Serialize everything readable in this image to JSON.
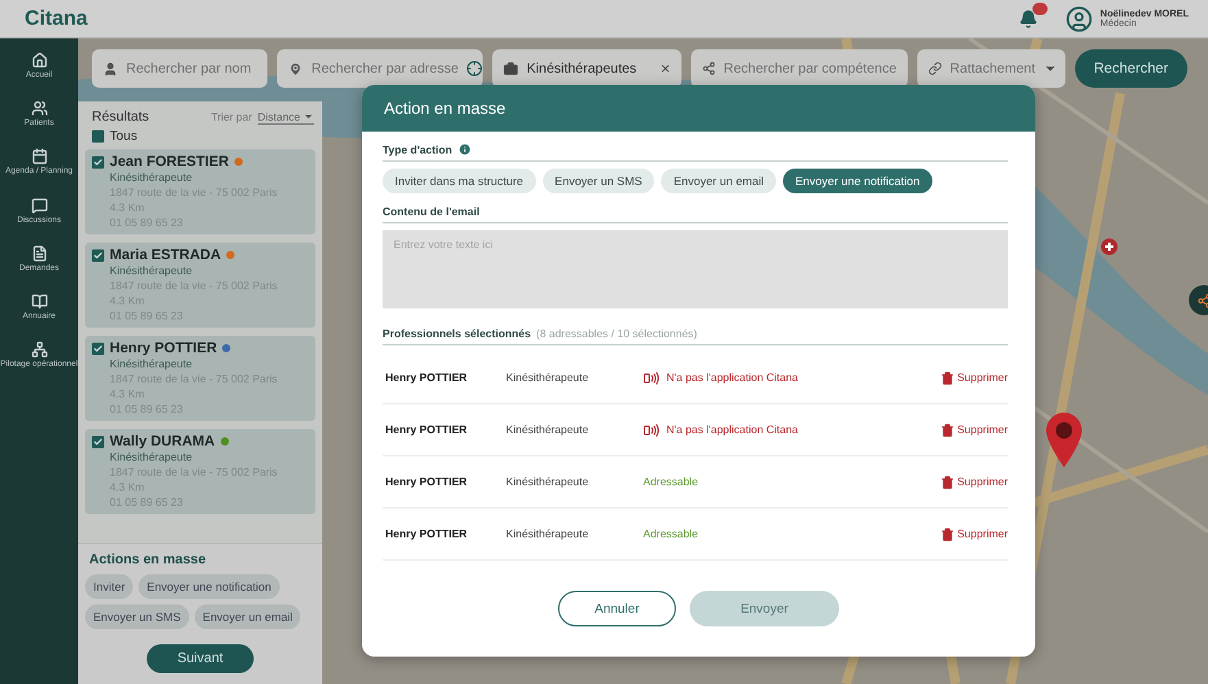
{
  "header": {
    "logo": "Citana",
    "notifications": true,
    "user": {
      "name": "Noëlinedev MOREL",
      "role": "Médecin"
    }
  },
  "sidebar": {
    "items": [
      {
        "kind": "home",
        "label": "Accueil"
      },
      {
        "kind": "patients",
        "label": "Patients"
      },
      {
        "kind": "agenda",
        "label": "Agenda / Planning"
      },
      {
        "kind": "chat",
        "label": "Discussions"
      },
      {
        "kind": "doc",
        "label": "Demandes"
      },
      {
        "kind": "directory",
        "label": "Annuaire"
      },
      {
        "kind": "network",
        "label": "Pilotage opérationnel"
      }
    ]
  },
  "search": {
    "name": {
      "placeholder": "Rechercher par nom"
    },
    "address": {
      "placeholder": "Rechercher par adresse"
    },
    "profession": {
      "value": "Kinésithérapeutes",
      "clear": "×"
    },
    "competence": {
      "placeholder": "Rechercher par compétence"
    },
    "attachment": {
      "placeholder": "Rattachement"
    },
    "submit": "Rechercher"
  },
  "results": {
    "title": "Résultats",
    "sort_label": "Trier par",
    "sort_value": "Distance",
    "all": {
      "label": "Tous",
      "checked": true
    },
    "items": [
      {
        "name": "Jean FORESTIER",
        "color": "#d2691e",
        "checked": true,
        "profession": "Kinésithérapeute",
        "address": "1847 route de la vie - 75 002 Paris",
        "distance": "4.3 Km",
        "phone": "01 05 89 65 23"
      },
      {
        "name": "Maria ESTRADA",
        "color": "#d2691e",
        "checked": true,
        "profession": "Kinésithérapeute",
        "address": "1847 route de la vie - 75 002 Paris",
        "distance": "4.3 Km",
        "phone": "01 05 89 65 23"
      },
      {
        "name": "Henry POTTIER",
        "color": "#3f6aa8",
        "checked": true,
        "profession": "Kinésithérapeute",
        "address": "1847 route de la vie - 75 002 Paris",
        "distance": "4.3 Km",
        "phone": "01 05 89 65 23"
      },
      {
        "name": "Wally DURAMA",
        "color": "#4e8f1f",
        "checked": true,
        "profession": "Kinésithérapeute",
        "address": "1847 route de la vie - 75 002 Paris",
        "distance": "4.3 Km",
        "phone": "01 05 89 65 23"
      }
    ]
  },
  "mass_actions": {
    "title": "Actions en masse",
    "actions": [
      "Inviter",
      "Envoyer une notification",
      "Envoyer un SMS",
      "Envoyer un email"
    ],
    "next": "Suivant"
  },
  "modal": {
    "title": "Action en masse",
    "action_type": {
      "label": "Type d'action",
      "options": [
        {
          "label": "Inviter dans ma structure",
          "selected": false
        },
        {
          "label": "Envoyer un SMS",
          "selected": false
        },
        {
          "label": "Envoyer un email",
          "selected": false
        },
        {
          "label": "Envoyer une notification",
          "selected": true
        }
      ]
    },
    "content": {
      "label": "Contenu de l'email",
      "placeholder": "Entrez votre texte ici"
    },
    "selected": {
      "label": "Professionnels sélectionnés",
      "count": "(8 adressables / 10 sélectionnés)",
      "rows": [
        {
          "name": "Henry POTTIER",
          "profession": "Kinésithérapeute",
          "kind": "no_app",
          "status": "N'a pas l'application Citana",
          "remove": "Supprimer"
        },
        {
          "name": "Henry POTTIER",
          "profession": "Kinésithérapeute",
          "kind": "no_app",
          "status": "N'a pas l'application Citana",
          "remove": "Supprimer"
        },
        {
          "name": "Henry POTTIER",
          "profession": "Kinésithérapeute",
          "kind": "addressable",
          "status": "Adressable",
          "remove": "Supprimer"
        },
        {
          "name": "Henry POTTIER",
          "profession": "Kinésithérapeute",
          "kind": "addressable",
          "status": "Adressable",
          "remove": "Supprimer"
        }
      ]
    },
    "cancel": "Annuler",
    "send": {
      "label": "Envoyer",
      "disabled": true
    }
  }
}
